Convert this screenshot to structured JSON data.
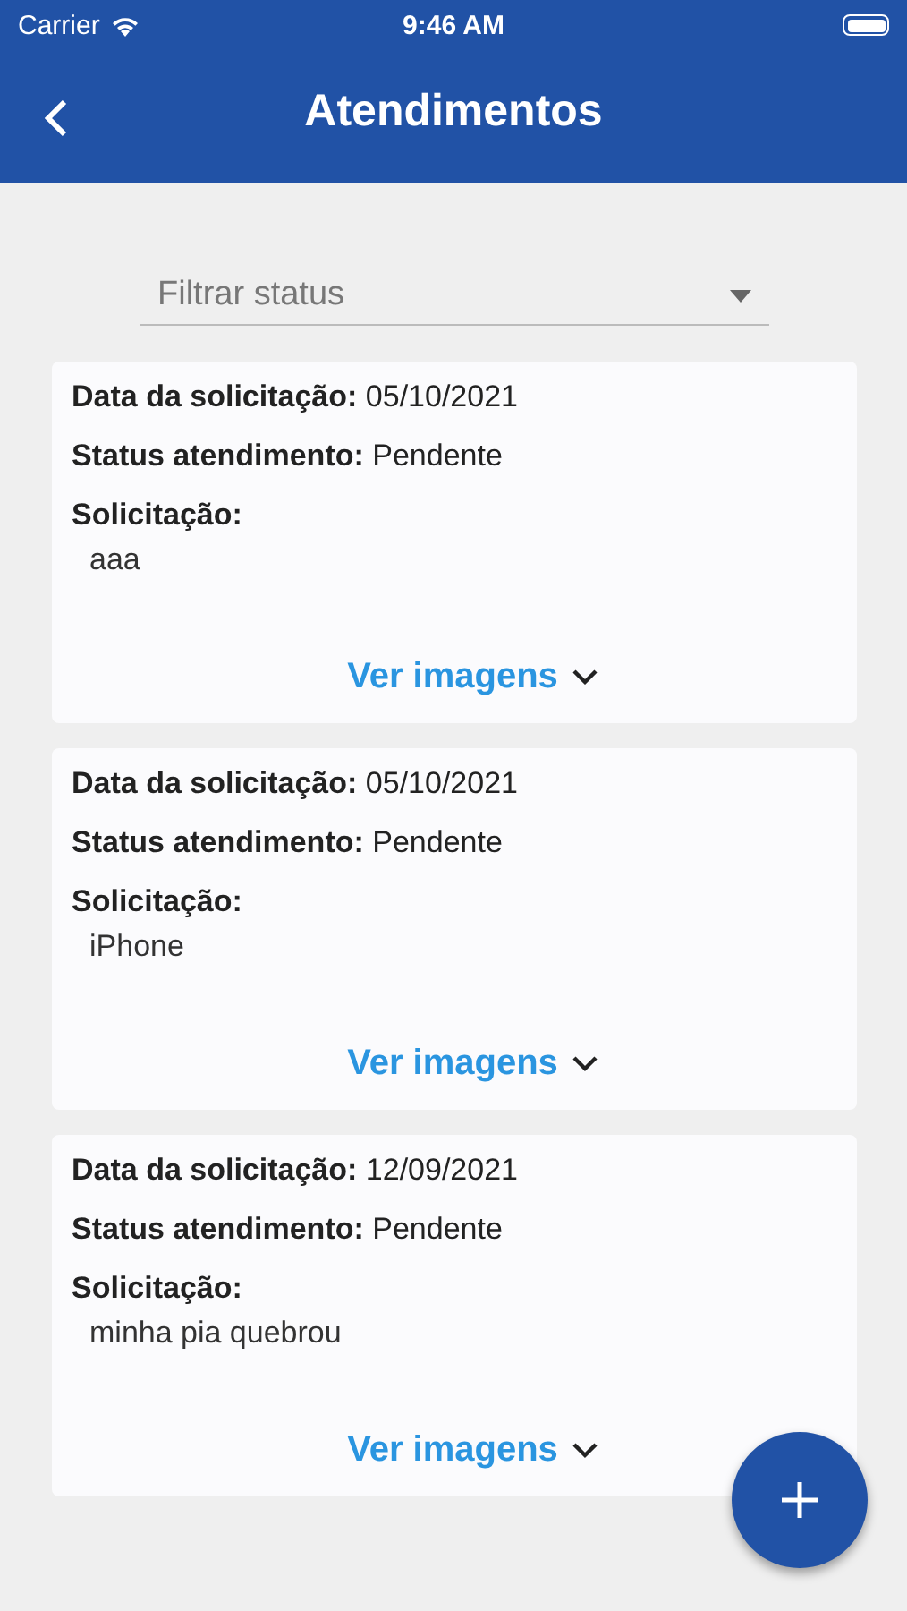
{
  "status_bar": {
    "carrier": "Carrier",
    "time": "9:46 AM"
  },
  "header": {
    "title": "Atendimentos"
  },
  "filter": {
    "placeholder": "Filtrar status"
  },
  "requests": [
    {
      "date_label": "Data da solicitação:",
      "date": "05/10/2021",
      "status_label": "Status atendimento:",
      "status": "Pendente",
      "request_label": "Solicitação:",
      "request": "aaa",
      "images_link": "Ver imagens"
    },
    {
      "date_label": "Data da solicitação:",
      "date": "05/10/2021",
      "status_label": "Status atendimento:",
      "status": "Pendente",
      "request_label": "Solicitação:",
      "request": "iPhone",
      "images_link": "Ver imagens"
    },
    {
      "date_label": "Data da solicitação:",
      "date": "12/09/2021",
      "status_label": "Status atendimento:",
      "status": "Pendente",
      "request_label": "Solicitação:",
      "request": "minha pia quebrou",
      "images_link": "Ver imagens"
    }
  ]
}
